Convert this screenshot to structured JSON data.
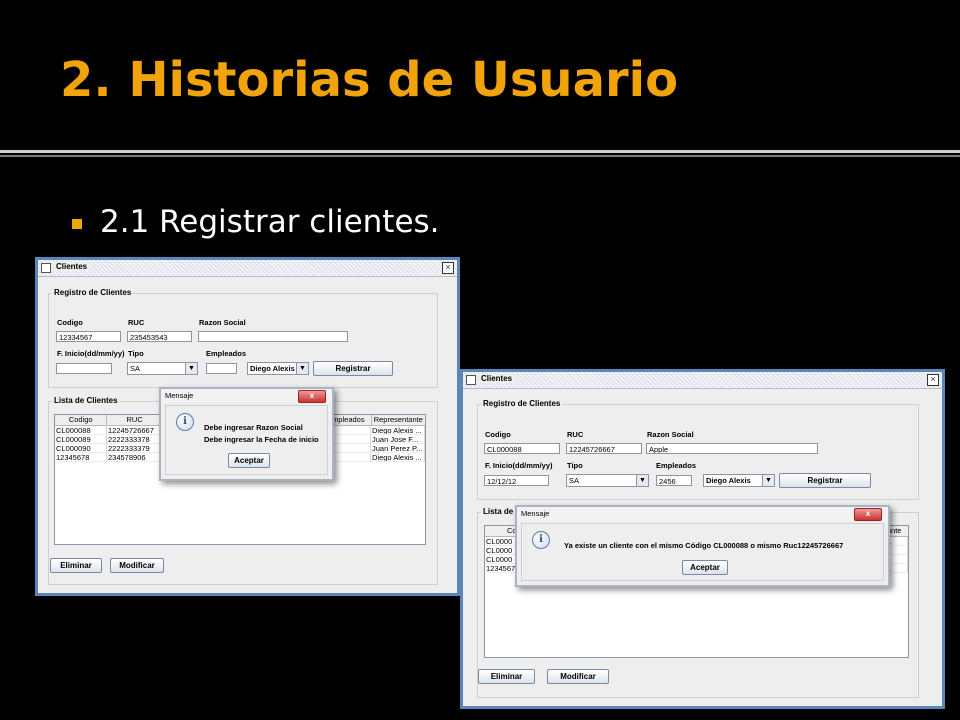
{
  "slide": {
    "title": "2. Historias de Usuario",
    "subtitle": "2.1  Registrar clientes."
  },
  "win1": {
    "title": "Clientes",
    "registro_group": "Registro de Clientes",
    "codigo_label": "Codigo",
    "ruc_label": "RUC",
    "razon_label": "Razon Social",
    "codigo_value": "12334567",
    "ruc_value": "235453543",
    "razon_value": "",
    "finicio_label": "F. Inicio(dd/mm/yy)",
    "tipo_label": "Tipo",
    "empleados_label": "Empleados",
    "finicio_value": "",
    "tipo_value": "SA",
    "empleados_value": "",
    "rep_value": "Diego Alexis",
    "registrar": "Registrar",
    "lista_group": "Lista de Clientes",
    "columns": [
      "Codigo",
      "RUC",
      "mpleados",
      "Representante"
    ],
    "rows": [
      {
        "codigo": "CL000088",
        "ruc": "12245726667",
        "rep": "Diego Alexis ..."
      },
      {
        "codigo": "CL000089",
        "ruc": "2222333378",
        "rep": "Juan Jose F..."
      },
      {
        "codigo": "CL000090",
        "ruc": "2222333379",
        "rep": "Juan Perez P..."
      },
      {
        "codigo": "12345678",
        "ruc": "234578906",
        "rep": "Diego Alexis ..."
      }
    ],
    "eliminar": "Eliminar",
    "modificar": "Modificar",
    "dialog": {
      "title": "Mensaje",
      "line1": "Debe ingresar Razon Social",
      "line2": "Debe ingresar la Fecha de inicio",
      "ok": "Aceptar",
      "close": "x"
    }
  },
  "win2": {
    "title": "Clientes",
    "registro_group": "Registro de Clientes",
    "codigo_label": "Codigo",
    "ruc_label": "RUC",
    "razon_label": "Razon Social",
    "codigo_value": "CL000088",
    "ruc_value": "12245726667",
    "razon_value": "Apple",
    "finicio_label": "F. Inicio(dd/mm/yy)",
    "tipo_label": "Tipo",
    "empleados_label": "Empleados",
    "finicio_value": "12/12/12",
    "tipo_value": "SA",
    "empleados_value": "2456",
    "rep_value": "Diego Alexis",
    "registrar": "Registrar",
    "lista_group": "Lista de C",
    "columns": [
      "Codi",
      "tante"
    ],
    "rows": [
      {
        "codigo": "CL0000",
        "rep": "s ..."
      },
      {
        "codigo": "CL0000",
        "rep": "F..."
      },
      {
        "codigo": "CL0000",
        "rep": "P..."
      },
      {
        "codigo": "1234567",
        "rep": "s ..."
      }
    ],
    "eliminar": "Eliminar",
    "modificar": "Modificar",
    "dialog": {
      "title": "Mensaje",
      "line1": "Ya existe un cliente con el mismo Código CL000088 o mismo Ruc12245726667",
      "ok": "Aceptar",
      "close": "x"
    }
  },
  "colors": {
    "title": "#f0a30a",
    "background": "#000000",
    "window_border": "#5b86b8"
  }
}
